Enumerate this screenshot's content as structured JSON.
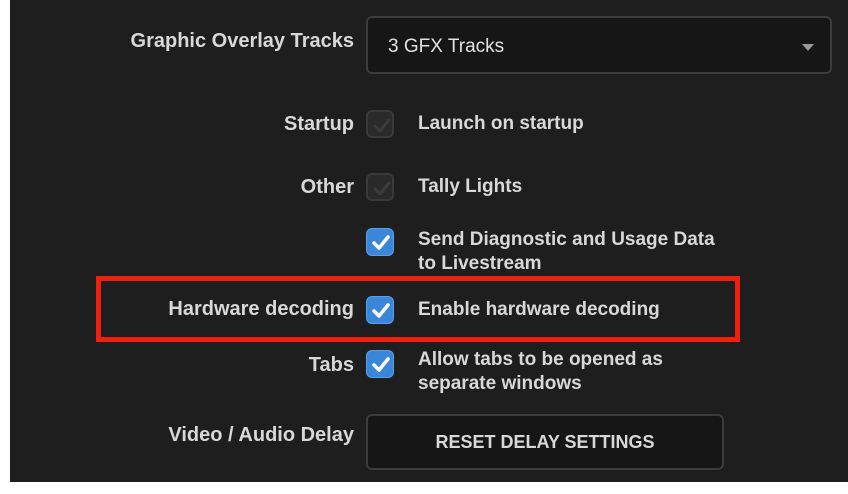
{
  "graphic_overlay": {
    "label": "Graphic Overlay Tracks",
    "selected": "3 GFX Tracks"
  },
  "startup": {
    "label": "Startup",
    "options": [
      {
        "text": "Launch on startup",
        "checked": true,
        "enabled": false
      }
    ]
  },
  "other": {
    "label": "Other",
    "options": [
      {
        "text": "Tally Lights",
        "checked": true,
        "enabled": false
      },
      {
        "text": "Send Diagnostic and Usage Data to Livestream",
        "line1": "Send Diagnostic and Usage Data",
        "line2": "to Livestream",
        "checked": true,
        "enabled": true
      }
    ]
  },
  "hardware_decoding": {
    "label": "Hardware decoding",
    "option": {
      "text": "Enable hardware decoding",
      "checked": true,
      "enabled": true
    }
  },
  "tabs": {
    "label": "Tabs",
    "option": {
      "text": "Allow tabs to be opened as separate windows",
      "line1": "Allow tabs to be opened as",
      "line2": "separate windows",
      "checked": true,
      "enabled": true
    }
  },
  "video_audio_delay": {
    "label": "Video / Audio Delay",
    "button": "RESET DELAY SETTINGS"
  },
  "colors": {
    "panel_bg": "#1e1e1e",
    "checkbox_checked": "#3a86d8",
    "highlight": "#f02010",
    "text": "#d8d8d8"
  }
}
